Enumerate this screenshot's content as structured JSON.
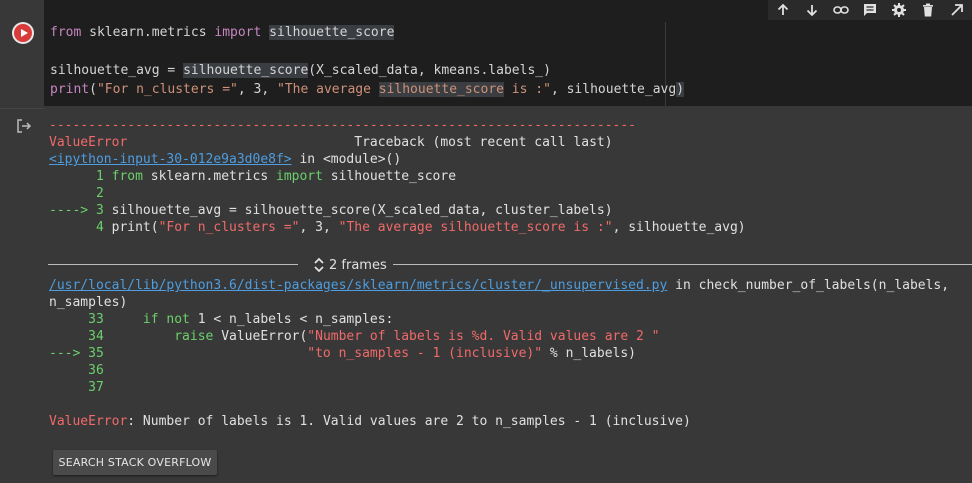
{
  "cell": {
    "code": {
      "line1": {
        "kw1": "from",
        "mod": " sklearn.metrics ",
        "kw2": "import",
        "sp": " ",
        "name": "silhouette_score"
      },
      "line3": {
        "a": "silhouette_avg = ",
        "fn": "silhouette_score",
        "b": "(X_scaled_data, kmeans.labels_)"
      },
      "line4": {
        "fn": "print",
        "a": "(",
        "s1": "\"For n_clusters =\"",
        "b": ", 3, ",
        "s2a": "\"The average ",
        "s2h": "silhouette_score",
        "s2b": " is :\"",
        "c": ", silhouette_avg",
        "d": ")"
      }
    }
  },
  "output": {
    "dashes": "---------------------------------------------------------------------------",
    "error_name": "ValueError",
    "traceback_pad": "                             ",
    "traceback_label": "Traceback (most recent call last)",
    "input_link": "<ipython-input-30-012e9a3d0e8f>",
    "in_module": " in <module>()",
    "tb_lines": [
      {
        "prefix": "      1 ",
        "parts": [
          {
            "t": "from",
            "c": "green"
          },
          {
            "t": " sklearn.metrics ",
            "c": ""
          },
          {
            "t": "import",
            "c": "green"
          },
          {
            "t": " silhouette_score",
            "c": ""
          }
        ]
      },
      {
        "prefix": "      2",
        "parts": []
      },
      {
        "prefix": "----> 3 ",
        "parts": [
          {
            "t": "silhouette_avg = silhouette_score(X_scaled_data, cluster_labels)",
            "c": ""
          }
        ]
      },
      {
        "prefix": "      4 ",
        "parts": [
          {
            "t": "print(",
            "c": ""
          },
          {
            "t": "\"For n_clusters =\"",
            "c": "red"
          },
          {
            "t": ", 3, ",
            "c": ""
          },
          {
            "t": "\"The average silhouette_score is :\"",
            "c": "red"
          },
          {
            "t": ", silhouette_avg)",
            "c": ""
          }
        ]
      }
    ],
    "frames_label": "2 frames",
    "file_link": "/usr/local/lib/python3.6/dist-packages/sklearn/metrics/cluster/_unsupervised.py",
    "file_in": " in check_number_of_labels(n_labels,",
    "file_cont": "n_samples)",
    "src_lines": [
      {
        "prefix": "     33     ",
        "parts": [
          {
            "t": "if",
            "c": "green"
          },
          {
            "t": " ",
            "c": ""
          },
          {
            "t": "not",
            "c": "green"
          },
          {
            "t": " 1 < n_labels < n_samples:",
            "c": ""
          }
        ]
      },
      {
        "prefix": "     34         ",
        "parts": [
          {
            "t": "raise",
            "c": "green"
          },
          {
            "t": " ValueError(",
            "c": ""
          },
          {
            "t": "\"Number of labels is %d. Valid values are 2 \"",
            "c": "red"
          }
        ]
      },
      {
        "prefix": "---> 35                          ",
        "parts": [
          {
            "t": "\"to n_samples - 1 (inclusive)\"",
            "c": "red"
          },
          {
            "t": " % n_labels)",
            "c": ""
          }
        ]
      },
      {
        "prefix": "     36",
        "parts": []
      },
      {
        "prefix": "     37",
        "parts": []
      }
    ],
    "final_error_name": "ValueError",
    "final_error_msg": ": Number of labels is 1. Valid values are 2 to n_samples - 1 (inclusive)",
    "so_button": "SEARCH STACK OVERFLOW"
  },
  "toolbar": {
    "icons": [
      "arrow-up-icon",
      "arrow-down-icon",
      "link-icon",
      "comment-icon",
      "gear-icon",
      "trash-icon",
      "open-external-icon"
    ]
  }
}
